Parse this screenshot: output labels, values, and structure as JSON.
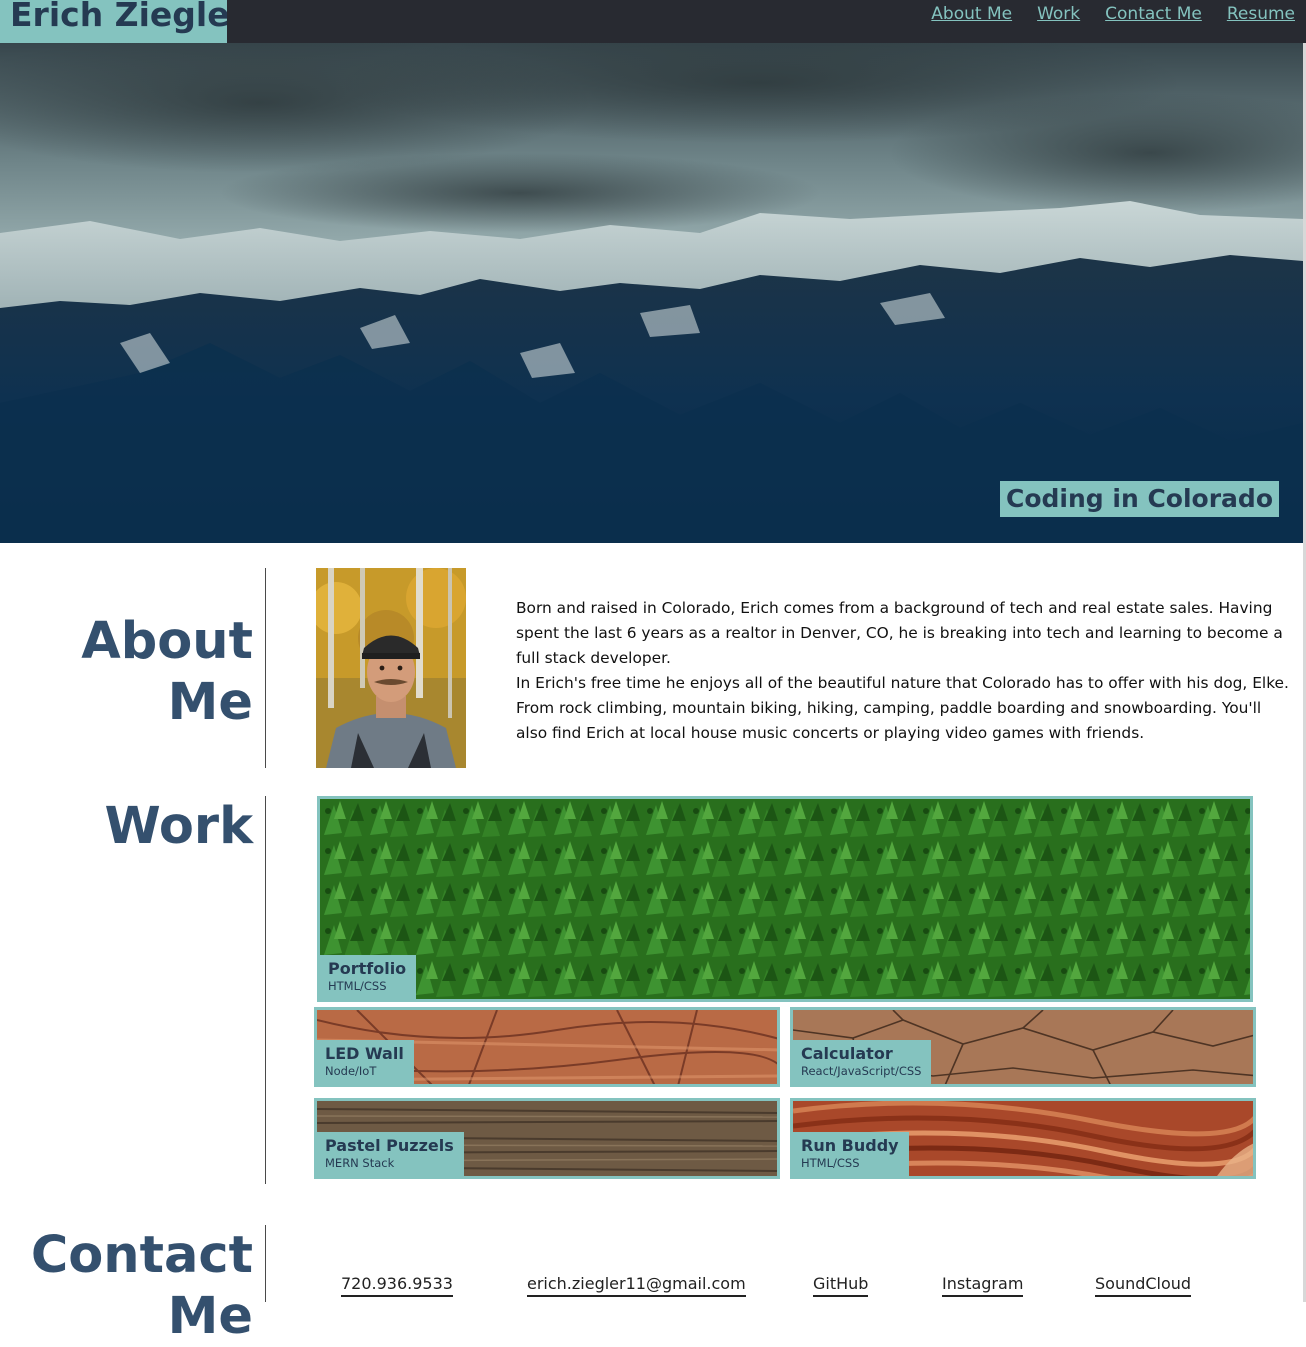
{
  "header": {
    "brand": "Erich Ziegler",
    "nav": [
      {
        "label": "About Me"
      },
      {
        "label": "Work"
      },
      {
        "label": "Contact Me"
      },
      {
        "label": "Resume"
      }
    ]
  },
  "hero": {
    "caption": "Coding in Colorado"
  },
  "about": {
    "title_line1": "About",
    "title_line2": "Me",
    "paragraph1": "Born and raised in Colorado, Erich comes from a background of tech and real estate sales. Having spent the last 6 years as a realtor in Denver, CO, he is breaking into tech and learning to become a full stack developer.",
    "paragraph2": "In Erich's free time he enjoys all of the beautiful nature that Colorado has to offer with his dog, Elke. From rock climbing, mountain biking, hiking, camping, paddle boarding and snowboarding. You'll also find Erich at local house music concerts or playing video games with friends."
  },
  "work": {
    "title": "Work",
    "projects": [
      {
        "name": "Portfolio",
        "stack": "HTML/CSS"
      },
      {
        "name": "LED Wall",
        "stack": "Node/IoT"
      },
      {
        "name": "Calculator",
        "stack": "React/JavaScript/CSS"
      },
      {
        "name": "Pastel Puzzels",
        "stack": "MERN Stack"
      },
      {
        "name": "Run Buddy",
        "stack": "HTML/CSS"
      }
    ]
  },
  "contact": {
    "title_line1": "Contact",
    "title_line2": "Me",
    "links": [
      {
        "label": "720.936.9533"
      },
      {
        "label": "erich.ziegler11@gmail.com"
      },
      {
        "label": "GitHub"
      },
      {
        "label": "Instagram"
      },
      {
        "label": "SoundCloud"
      }
    ]
  },
  "colors": {
    "accent": "#84c3bf",
    "header_bg": "#282a31",
    "heading": "#34506e",
    "brand_text": "#253a52"
  }
}
